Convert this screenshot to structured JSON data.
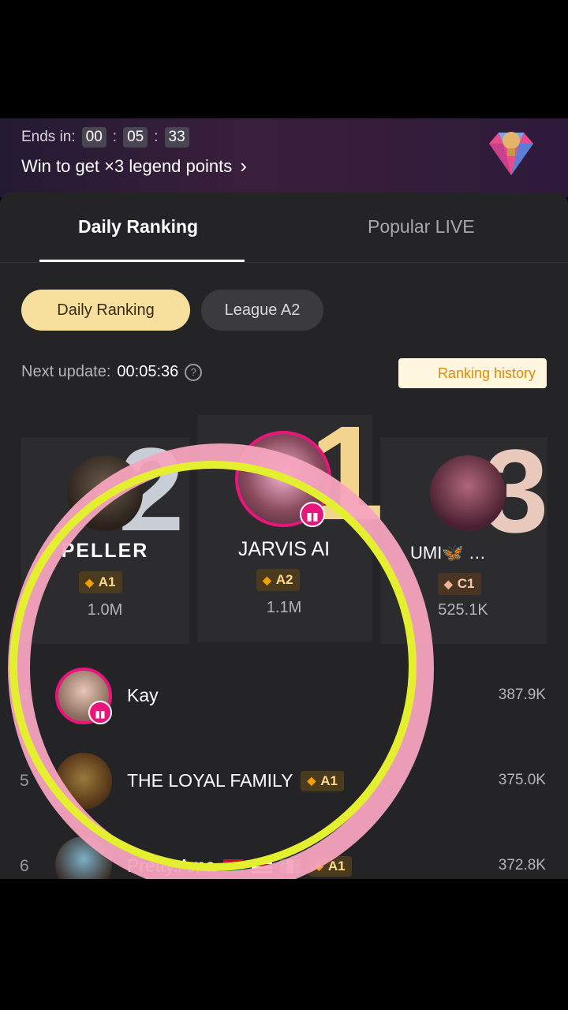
{
  "banner": {
    "ends_label": "Ends in:",
    "timer": [
      "00",
      "05",
      "33"
    ],
    "win_text": "Win to get ×3 legend points",
    "chevron": "›",
    "trophy_icon": "diamond-trophy-icon"
  },
  "tabs": [
    {
      "label": "Daily Ranking",
      "active": true
    },
    {
      "label": "Popular LIVE",
      "active": false
    }
  ],
  "chips": {
    "daily": "Daily Ranking",
    "league": "League A2"
  },
  "update": {
    "label": "Next update:",
    "value": "00:05:36",
    "help": "?"
  },
  "history_button": "Ranking history",
  "podium": {
    "first": {
      "rank": "1",
      "name": "JARVIS AI",
      "league": "A2",
      "score": "1.1M",
      "live": true
    },
    "second": {
      "rank": "2",
      "name": "PELLER",
      "league": "A1",
      "score": "1.0M",
      "live": false
    },
    "third": {
      "rank": "3",
      "name": "UMI🦋 …",
      "league": "C1",
      "score": "525.1K",
      "live": false
    }
  },
  "list": [
    {
      "rank": "4",
      "name": "Kay",
      "league": "",
      "score": "387.9K",
      "live": true
    },
    {
      "rank": "5",
      "name": "THE LOYAL FAMILY",
      "league": "A1",
      "score": "375.0K",
      "live": false
    },
    {
      "rank": "6",
      "name": "Pretty.Ama",
      "league": "A1",
      "score": "372.8K",
      "live": false
    }
  ],
  "colors": {
    "live_pink": "#e8157a",
    "gold": "#f3d48f",
    "annotation_pink": "#f7a4bf",
    "annotation_yellow": "#e4ef2f"
  }
}
